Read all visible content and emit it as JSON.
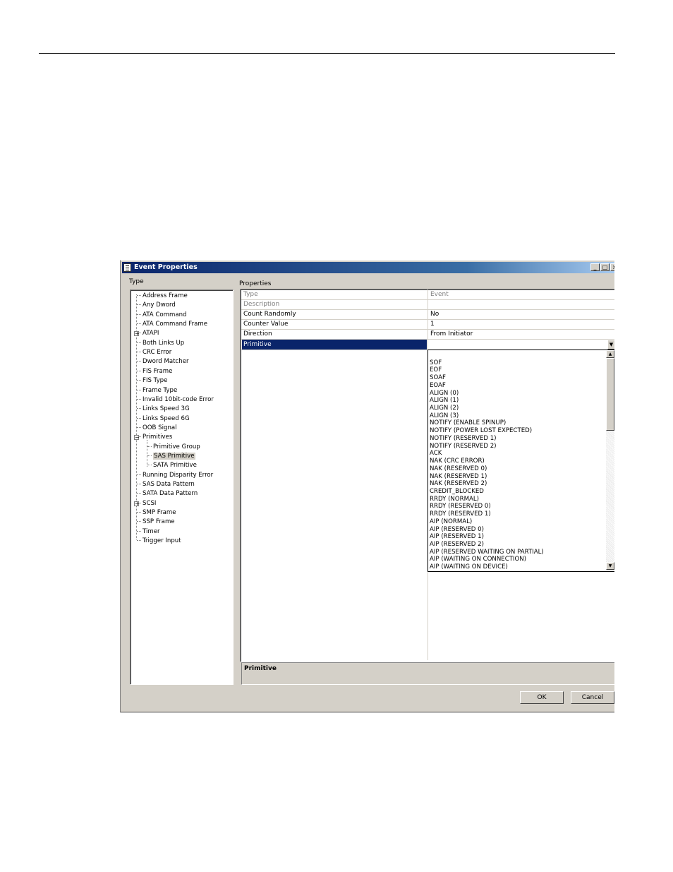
{
  "dialog": {
    "title": "Event Properties",
    "minimize": "_",
    "maximize": "□",
    "close": "×",
    "type_label": "Type",
    "properties_label": "Properties"
  },
  "tree": {
    "items": [
      {
        "label": "Address Frame"
      },
      {
        "label": "Any Dword"
      },
      {
        "label": "ATA Command"
      },
      {
        "label": "ATA Command Frame"
      },
      {
        "label": "ATAPI",
        "expander": "+"
      },
      {
        "label": "Both Links Up"
      },
      {
        "label": "CRC Error"
      },
      {
        "label": "Dword Matcher"
      },
      {
        "label": "FIS Frame"
      },
      {
        "label": "FIS Type"
      },
      {
        "label": "Frame Type"
      },
      {
        "label": "Invalid 10bit-code Error"
      },
      {
        "label": "Links Speed 3G"
      },
      {
        "label": "Links Speed 6G"
      },
      {
        "label": "OOB Signal"
      },
      {
        "label": "Primitives",
        "expander": "−"
      },
      {
        "label": "Primitive Group",
        "child": true
      },
      {
        "label": "SAS Primitive",
        "child": true,
        "selected": true
      },
      {
        "label": "SATA Primitive",
        "child": true
      },
      {
        "label": "Running Disparity Error"
      },
      {
        "label": "SAS Data Pattern"
      },
      {
        "label": "SATA Data Pattern"
      },
      {
        "label": "SCSI",
        "expander": "+"
      },
      {
        "label": "SMP Frame"
      },
      {
        "label": "SSP Frame"
      },
      {
        "label": "Timer"
      },
      {
        "label": "Trigger Input"
      }
    ]
  },
  "properties": {
    "rows": [
      {
        "name": "Type",
        "value": "Event",
        "dim": true
      },
      {
        "name": "Description",
        "value": "",
        "dim": true
      },
      {
        "name": "Count Randomly",
        "value": "No"
      },
      {
        "name": "Counter Value",
        "value": "1"
      },
      {
        "name": "Direction",
        "value": "From Initiator"
      },
      {
        "name": "Primitive",
        "value": "",
        "active": true
      }
    ],
    "combo_arrow": "▼"
  },
  "dropdown": {
    "scroll_up": "▲",
    "scroll_down": "▼",
    "options": [
      "",
      "SOF",
      "EOF",
      "SOAF",
      "EOAF",
      "ALIGN (0)",
      "ALIGN (1)",
      "ALIGN (2)",
      "ALIGN (3)",
      "NOTIFY (ENABLE SPINUP)",
      "NOTIFY (POWER LOST EXPECTED)",
      "NOTIFY (RESERVED 1)",
      "NOTIFY (RESERVED 2)",
      "ACK",
      "NAK (CRC ERROR)",
      "NAK (RESERVED 0)",
      "NAK (RESERVED 1)",
      "NAK (RESERVED 2)",
      "CREDIT_BLOCKED",
      "RRDY (NORMAL)",
      "RRDY (RESERVED 0)",
      "RRDY (RESERVED 1)",
      "AIP (NORMAL)",
      "AIP (RESERVED 0)",
      "AIP (RESERVED 1)",
      "AIP (RESERVED 2)",
      "AIP (RESERVED WAITING ON PARTIAL)",
      "AIP (WAITING ON CONNECTION)",
      "AIP (WAITING ON DEVICE)"
    ]
  },
  "description_panel": {
    "title": "Primitive"
  },
  "buttons": {
    "ok": "OK",
    "cancel": "Cancel"
  }
}
